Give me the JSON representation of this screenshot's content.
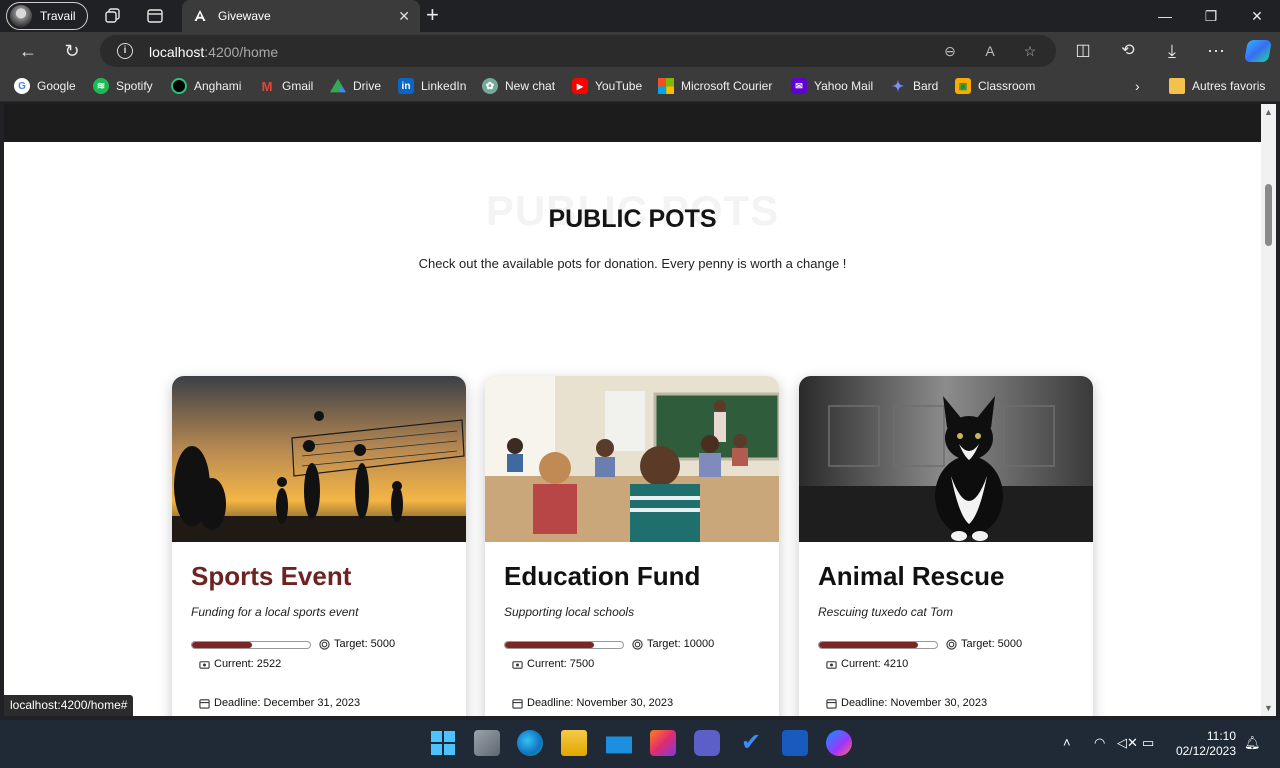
{
  "browser": {
    "profile_name": "Travail",
    "tab_title": "Givewave",
    "url_host": "localhost",
    "url_path": ":4200/home",
    "status_link": "localhost:4200/home#"
  },
  "bookmarks": [
    {
      "label": "Google",
      "icon": "google-icon",
      "color": "#ffffff"
    },
    {
      "label": "Spotify",
      "icon": "spotify-icon",
      "color": "#1db954"
    },
    {
      "label": "Anghami",
      "icon": "anghami-icon",
      "color": "#000000"
    },
    {
      "label": "Gmail",
      "icon": "gmail-icon",
      "color": "#ea4335"
    },
    {
      "label": "Drive",
      "icon": "drive-icon",
      "color": "#34a853"
    },
    {
      "label": "LinkedIn",
      "icon": "linkedin-icon",
      "color": "#0a66c2"
    },
    {
      "label": "New chat",
      "icon": "chatgpt-icon",
      "color": "#74aa9c"
    },
    {
      "label": "YouTube",
      "icon": "youtube-icon",
      "color": "#ff0000"
    },
    {
      "label": "Microsoft Courier",
      "icon": "microsoft-icon",
      "color": "#f25022"
    },
    {
      "label": "Yahoo Mail",
      "icon": "yahoo-icon",
      "color": "#6001d2"
    },
    {
      "label": "Bard",
      "icon": "bard-icon",
      "color": "#4f7df0"
    },
    {
      "label": "Classroom",
      "icon": "classroom-icon",
      "color": "#f9ab00"
    }
  ],
  "other_favorites": "Autres favoris",
  "page": {
    "bg_word": "PUBLIC POTS",
    "title": "PUBLIC POTS",
    "subtitle": "Check out the available pots for donation. Every penny is worth a change !"
  },
  "cards": [
    {
      "title": "Sports Event",
      "description": "Funding for a local sports event",
      "target_label": "Target: 5000",
      "current_label": "Current: 2522",
      "deadline_label": "Deadline: December 31, 2023",
      "progress": 0.5044,
      "image": "volleyball-sunset-image"
    },
    {
      "title": "Education Fund",
      "description": "Supporting local schools",
      "target_label": "Target: 10000",
      "current_label": "Current: 7500",
      "deadline_label": "Deadline: November 30, 2023",
      "progress": 0.75,
      "image": "classroom-image"
    },
    {
      "title": "Animal Rescue",
      "description": "Rescuing tuxedo cat Tom",
      "target_label": "Target: 5000",
      "current_label": "Current: 4210",
      "deadline_label": "Deadline: November 30, 2023",
      "progress": 0.842,
      "image": "tuxedo-cat-image"
    }
  ],
  "taskbar": {
    "time": "11:10",
    "date": "02/12/2023"
  },
  "colors": {
    "accent": "#7b2525",
    "title_accent": "#6e2323"
  }
}
